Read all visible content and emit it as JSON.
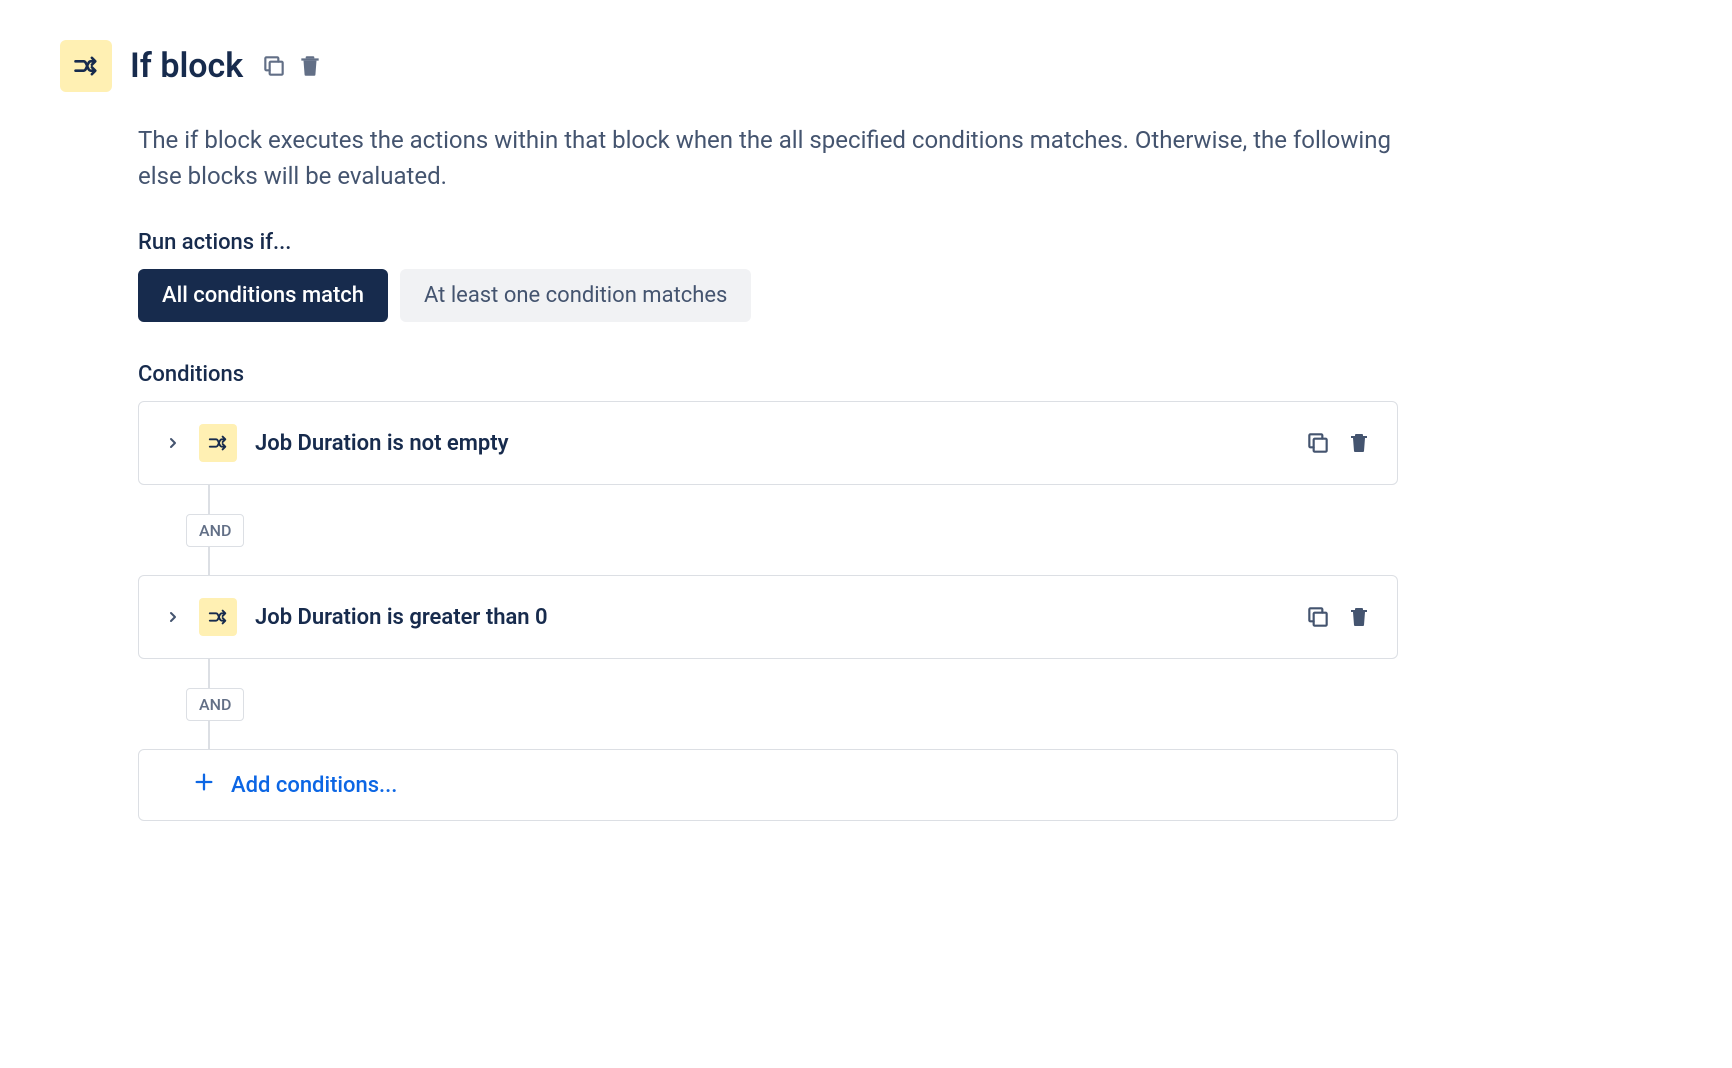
{
  "header": {
    "title": "If block",
    "description": "The if block executes the actions within that block when the all specified conditions matches. Otherwise, the following else blocks will be evaluated."
  },
  "runActions": {
    "label": "Run actions if...",
    "options": {
      "all": "All conditions match",
      "atLeastOne": "At least one condition matches"
    }
  },
  "conditions": {
    "label": "Conditions",
    "connector": "AND",
    "items": [
      {
        "text": "Job Duration is not empty"
      },
      {
        "text": "Job Duration is greater than 0"
      }
    ],
    "addLabel": "Add conditions..."
  }
}
